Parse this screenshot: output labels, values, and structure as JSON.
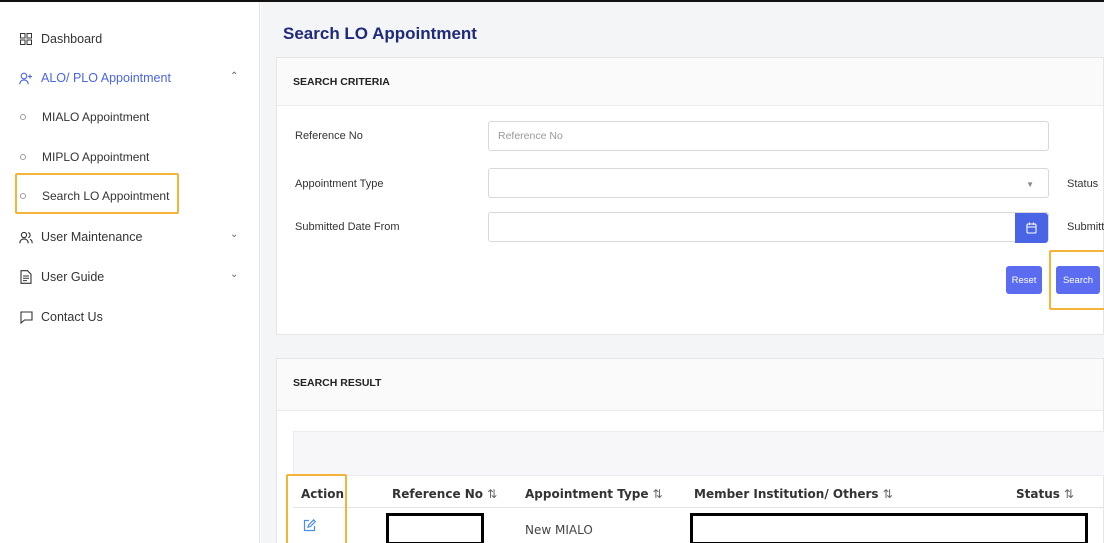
{
  "sidebar": {
    "items": [
      {
        "label": "Dashboard",
        "icon": "dashboard-grid-icon"
      },
      {
        "label": "ALO/ PLO Appointment",
        "icon": "user-add-icon"
      },
      {
        "label": "User Maintenance",
        "icon": "users-icon"
      },
      {
        "label": "User Guide",
        "icon": "document-icon"
      },
      {
        "label": "Contact Us",
        "icon": "chat-icon"
      }
    ],
    "sub_items": [
      {
        "label": "MIALO Appointment"
      },
      {
        "label": "MIPLO Appointment"
      },
      {
        "label": "Search LO Appointment"
      }
    ]
  },
  "main": {
    "title": "Search LO Appointment",
    "criteria": {
      "heading": "SEARCH CRITERIA",
      "reference_label": "Reference No",
      "reference_placeholder": "Reference No",
      "reference_value": "",
      "type_label": "Appointment Type",
      "status_label": "Status",
      "date_from_label": "Submitted Date From",
      "date_to_label_partial": "Submitte",
      "reset_label": "Reset",
      "search_label": "Search"
    },
    "result": {
      "heading": "SEARCH RESULT",
      "columns": [
        "Action",
        "Reference No",
        "Appointment Type",
        "Member Institution/ Others",
        "Status"
      ],
      "sort_icon": "⇅",
      "rows": [
        {
          "appointment_type": "New MIALO"
        }
      ]
    }
  },
  "colors": {
    "accent": "#4a64e6",
    "button": "#5b6cf0",
    "title": "#1f2a7a",
    "highlight": "#f4b43a"
  }
}
